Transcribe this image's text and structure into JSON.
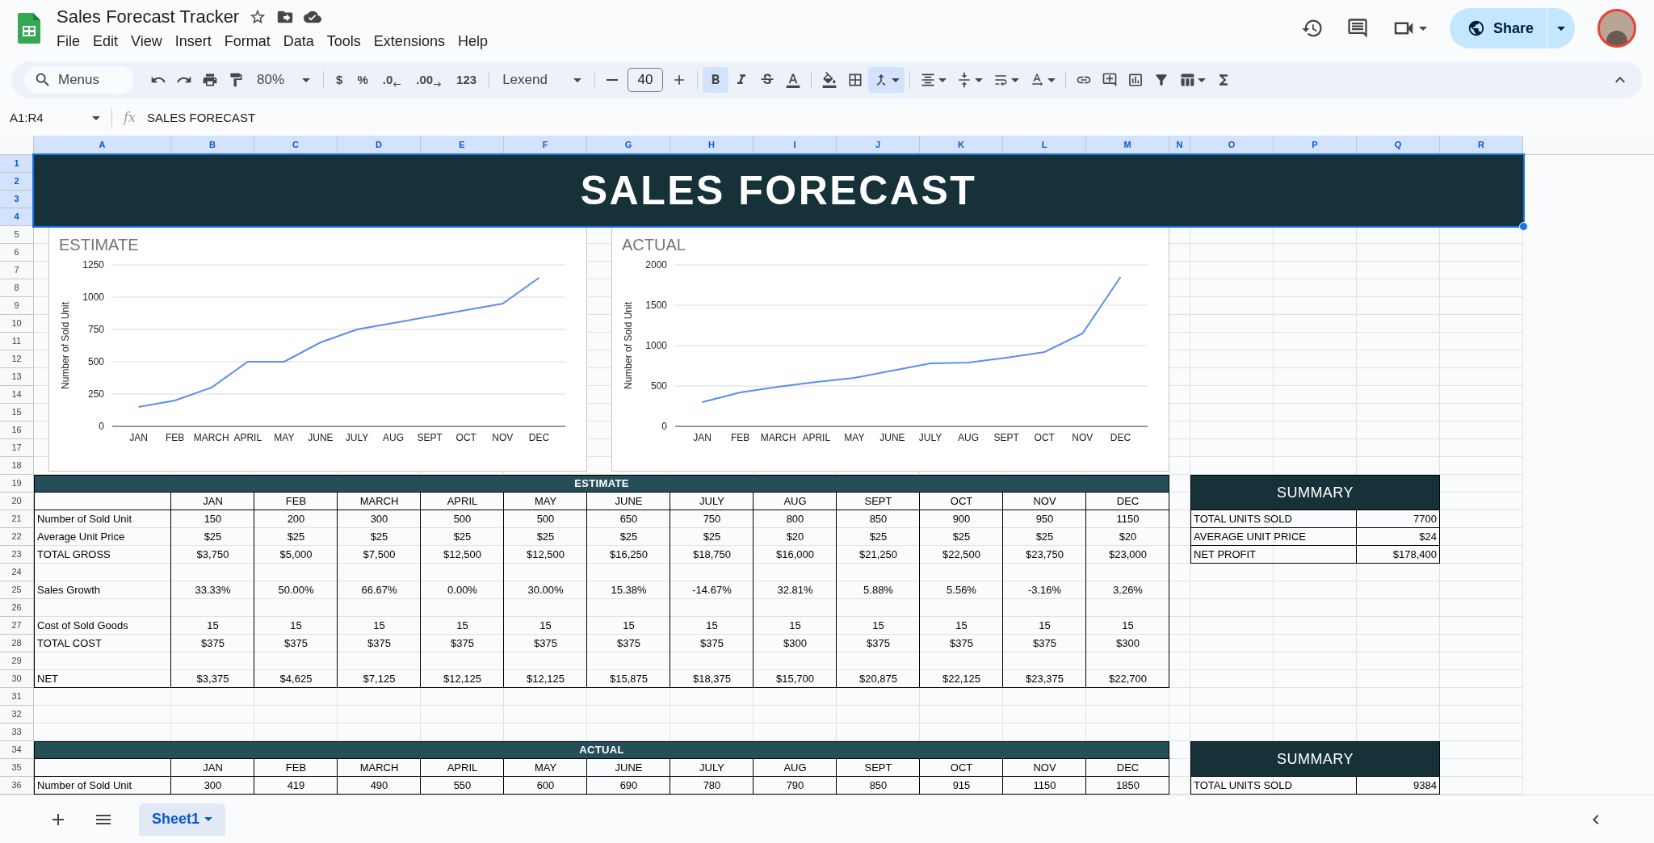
{
  "window": {
    "title": "Sales Forecast Tracker"
  },
  "menu": [
    "File",
    "Edit",
    "View",
    "Insert",
    "Format",
    "Data",
    "Tools",
    "Extensions",
    "Help"
  ],
  "share_button": {
    "label": "Share"
  },
  "toolbar": {
    "search_placeholder": "Menus",
    "zoom": "80%",
    "format_buttons": [
      "$",
      "%",
      ".0",
      ".00",
      "123"
    ],
    "font": "Lexend",
    "font_size": "40",
    "bold": {
      "selected": true
    },
    "merge": {
      "selected": true
    }
  },
  "formula_bar": {
    "name_box": "A1:R4",
    "fx_label": "fx",
    "formula": "SALES FORECAST"
  },
  "columns": [
    {
      "label": "A",
      "selected": true
    },
    {
      "label": "B",
      "selected": true
    },
    {
      "label": "C",
      "selected": true
    },
    {
      "label": "D",
      "selected": true
    },
    {
      "label": "E",
      "selected": true
    },
    {
      "label": "F",
      "selected": true
    },
    {
      "label": "G",
      "selected": true
    },
    {
      "label": "H",
      "selected": true
    },
    {
      "label": "I",
      "selected": true
    },
    {
      "label": "J",
      "selected": true
    },
    {
      "label": "K",
      "selected": true
    },
    {
      "label": "L",
      "selected": true
    },
    {
      "label": "M",
      "selected": true
    },
    {
      "label": "N",
      "selected": true
    },
    {
      "label": "O",
      "selected": true
    },
    {
      "label": "P",
      "selected": true
    },
    {
      "label": "Q",
      "selected": true
    },
    {
      "label": "R",
      "selected": true
    }
  ],
  "rows": [
    {
      "label": "1",
      "selected": true
    },
    {
      "label": "2",
      "selected": true
    },
    {
      "label": "3",
      "selected": true
    },
    {
      "label": "4",
      "selected": true
    },
    {
      "label": "5",
      "selected": false
    },
    {
      "label": "6",
      "selected": false
    },
    {
      "label": "7",
      "selected": false
    },
    {
      "label": "8",
      "selected": false
    },
    {
      "label": "9",
      "selected": false
    },
    {
      "label": "10",
      "selected": false
    },
    {
      "label": "11",
      "selected": false
    },
    {
      "label": "12",
      "selected": false
    },
    {
      "label": "13",
      "selected": false
    },
    {
      "label": "14",
      "selected": false
    },
    {
      "label": "15",
      "selected": false
    },
    {
      "label": "16",
      "selected": false
    },
    {
      "label": "17",
      "selected": false
    },
    {
      "label": "18",
      "selected": false
    },
    {
      "label": "19",
      "selected": false
    },
    {
      "label": "20",
      "selected": false
    },
    {
      "label": "21",
      "selected": false
    },
    {
      "label": "22",
      "selected": false
    },
    {
      "label": "23",
      "selected": false
    },
    {
      "label": "24",
      "selected": false
    },
    {
      "label": "25",
      "selected": false
    },
    {
      "label": "26",
      "selected": false
    },
    {
      "label": "27",
      "selected": false
    },
    {
      "label": "28",
      "selected": false
    },
    {
      "label": "29",
      "selected": false
    },
    {
      "label": "30",
      "selected": false
    },
    {
      "label": "31",
      "selected": false
    },
    {
      "label": "32",
      "selected": false
    },
    {
      "label": "33",
      "selected": false
    },
    {
      "label": "34",
      "selected": false
    },
    {
      "label": "35",
      "selected": false
    },
    {
      "label": "36",
      "selected": false
    }
  ],
  "banner": {
    "text": "SALES FORECAST"
  },
  "charts": [
    {
      "chart_data": {
        "type": "line",
        "title": "ESTIMATE",
        "ylabel": "Number of Sold Unit",
        "categories": [
          "JAN",
          "FEB",
          "MARCH",
          "APRIL",
          "MAY",
          "JUNE",
          "JULY",
          "AUG",
          "SEPT",
          "OCT",
          "NOV",
          "DEC"
        ],
        "series": [
          {
            "color": "#5b8def",
            "values": [
              150,
              200,
              300,
              500,
              500,
              650,
              750,
              800,
              850,
              900,
              950,
              1150
            ]
          }
        ],
        "grid": true,
        "ylim": [
          0,
          1250
        ],
        "yticks": [
          0,
          250,
          500,
          750,
          1000,
          1250
        ]
      }
    },
    {
      "chart_data": {
        "type": "line",
        "title": "ACTUAL",
        "ylabel": "Number of Sold Unit",
        "categories": [
          "JAN",
          "FEB",
          "MARCH",
          "APRIL",
          "MAY",
          "JUNE",
          "JULY",
          "AUG",
          "SEPT",
          "OCT",
          "NOV",
          "DEC"
        ],
        "series": [
          {
            "color": "#5b8def",
            "values": [
              300,
              420,
              490,
              550,
              600,
              690,
              780,
              790,
              850,
              920,
              1150,
              1850
            ]
          }
        ],
        "grid": true,
        "ylim": [
          0,
          2000
        ],
        "yticks": [
          0,
          500,
          1000,
          1500,
          2000
        ]
      }
    }
  ],
  "estimate_table": {
    "title": "ESTIMATE",
    "months": [
      "JAN",
      "FEB",
      "MARCH",
      "APRIL",
      "MAY",
      "JUNE",
      "JULY",
      "AUG",
      "SEPT",
      "OCT",
      "NOV",
      "DEC"
    ],
    "rows": [
      {
        "kind": "data",
        "label": "Number of Sold Unit",
        "values": [
          "150",
          "200",
          "300",
          "500",
          "500",
          "650",
          "750",
          "800",
          "850",
          "900",
          "950",
          "1150"
        ]
      },
      {
        "kind": "data",
        "label": "Average Unit Price",
        "values": [
          "$25",
          "$25",
          "$25",
          "$25",
          "$25",
          "$25",
          "$25",
          "$20",
          "$25",
          "$25",
          "$25",
          "$20"
        ]
      },
      {
        "kind": "data",
        "label": "TOTAL GROSS",
        "values": [
          "$3,750",
          "$5,000",
          "$7,500",
          "$12,500",
          "$12,500",
          "$16,250",
          "$18,750",
          "$16,000",
          "$21,250",
          "$22,500",
          "$23,750",
          "$23,000"
        ]
      },
      {
        "kind": "blank"
      },
      {
        "kind": "data",
        "label": "Sales Growth",
        "values": [
          "33.33%",
          "50.00%",
          "66.67%",
          "0.00%",
          "30.00%",
          "15.38%",
          "-14.67%",
          "32.81%",
          "5.88%",
          "5.56%",
          "-3.16%",
          "3.26%"
        ]
      },
      {
        "kind": "blank"
      },
      {
        "kind": "data",
        "label": "Cost of Sold Goods",
        "values": [
          "15",
          "15",
          "15",
          "15",
          "15",
          "15",
          "15",
          "15",
          "15",
          "15",
          "15",
          "15"
        ]
      },
      {
        "kind": "data",
        "label": "TOTAL COST",
        "values": [
          "$375",
          "$375",
          "$375",
          "$375",
          "$375",
          "$375",
          "$375",
          "$300",
          "$375",
          "$375",
          "$375",
          "$300"
        ]
      },
      {
        "kind": "blank"
      },
      {
        "kind": "data",
        "label": "NET",
        "values": [
          "$3,375",
          "$4,625",
          "$7,125",
          "$12,125",
          "$12,125",
          "$15,875",
          "$18,375",
          "$15,700",
          "$20,875",
          "$22,125",
          "$23,375",
          "$22,700"
        ]
      }
    ]
  },
  "estimate_summary": {
    "title": "SUMMARY",
    "items": [
      {
        "label": "TOTAL UNITS SOLD",
        "value": "7700"
      },
      {
        "label": "AVERAGE UNIT PRICE",
        "value": "$24"
      },
      {
        "label": "NET PROFIT",
        "value": "$178,400"
      }
    ]
  },
  "actual_table": {
    "title": "ACTUAL",
    "months": [
      "JAN",
      "FEB",
      "MARCH",
      "APRIL",
      "MAY",
      "JUNE",
      "JULY",
      "AUG",
      "SEPT",
      "OCT",
      "NOV",
      "DEC"
    ],
    "rows": [
      {
        "kind": "data",
        "label": "Number of Sold Unit",
        "values": [
          "300",
          "419",
          "490",
          "550",
          "600",
          "690",
          "780",
          "790",
          "850",
          "915",
          "1150",
          "1850"
        ]
      }
    ]
  },
  "actual_summary": {
    "title": "SUMMARY",
    "items": [
      {
        "label": "TOTAL UNITS SOLD",
        "value": "9384"
      }
    ]
  },
  "sheet_tabs": [
    {
      "label": "Sheet1",
      "selected": true
    }
  ]
}
